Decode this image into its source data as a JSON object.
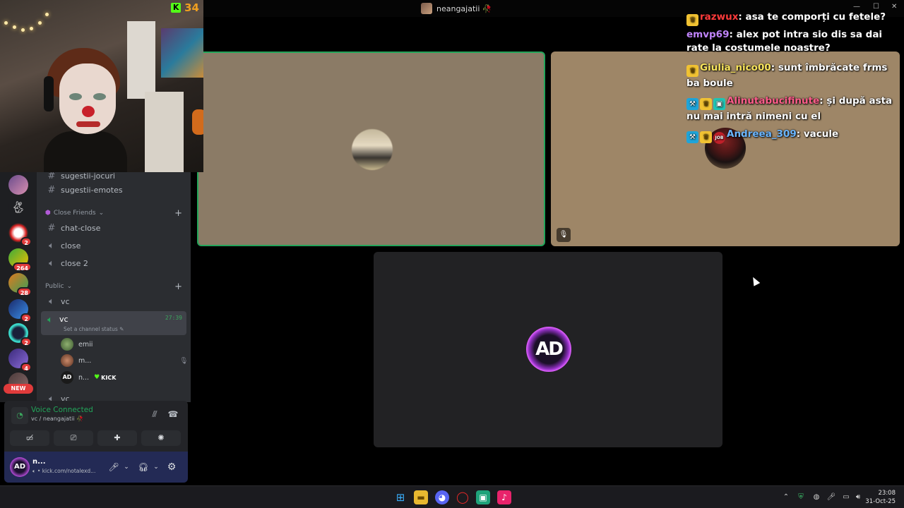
{
  "window": {
    "title": "neangajatii 🥀"
  },
  "webcam": {
    "kick_count": "34"
  },
  "servers": [
    {
      "icon": "server-anime-icon",
      "badge": ""
    },
    {
      "icon": "server-bunny-icon",
      "badge": ""
    },
    {
      "icon": "server-clown-icon",
      "badge": "2"
    },
    {
      "icon": "server-mario-icon",
      "badge": "264"
    },
    {
      "icon": "server-orange-icon",
      "badge": "28"
    },
    {
      "icon": "server-blue-icon",
      "badge": "2"
    },
    {
      "icon": "server-valorant-icon",
      "badge": "2"
    },
    {
      "icon": "server-purple-icon",
      "badge": "4"
    }
  ],
  "servers_new_label": "NEW",
  "channels": {
    "partial_top": "sugestii-jocuri",
    "sugestii_emotes": "sugestii-emotes",
    "cat_close_friends": "Close Friends",
    "chat_close": "chat-close",
    "close": "close",
    "close2": "close 2",
    "cat_public": "Public",
    "vc1": "vc",
    "vc_active": "vc",
    "vc_active_timer": "27:39",
    "vc_status_placeholder": "Set a channel status",
    "members": [
      {
        "name": "emii",
        "tag": ""
      },
      {
        "name": "m...",
        "tag": ""
      },
      {
        "name": "n...",
        "tag": "KICK"
      }
    ],
    "partial_bottom": "vc"
  },
  "voice": {
    "status": "Voice Connected",
    "location": "vc / neangajatii 🥀"
  },
  "user": {
    "name": "n...",
    "status": "kick.com/notalexd..."
  },
  "chat": [
    {
      "badges": [
        "crown",
        "sub"
      ],
      "user": "razwux",
      "color": "#ff3b3b",
      "text": "asa te comporți cu fetele?"
    },
    {
      "badges": [],
      "user": "emvp69",
      "color": "#c084fc",
      "text": "alex pot intra sio dis sa dai rate la costumele noastre?"
    },
    {
      "badges": [
        "crown"
      ],
      "user": "Giulia_nico00",
      "color": "#f8e45c",
      "text": "sunt îmbrăcate frms ba boule"
    },
    {
      "badges": [
        "mod",
        "crown",
        "sub"
      ],
      "user": "Alinutabucifinute",
      "color": "#ff5c8a",
      "text": "și după asta nu mai intră nimeni cu el"
    },
    {
      "badges": [
        "mod",
        "crown",
        "job"
      ],
      "user": "Andreea_309",
      "color": "#6bb6ff",
      "text": "vacule"
    }
  ],
  "tile3": {
    "avatar_text": "AD"
  },
  "clock": {
    "time": "23:08",
    "date": "31-Oct-25"
  },
  "colors": {
    "speaking_border": "#23a55a",
    "badge_red": "#e03b3b",
    "kick_green": "#53fc18"
  }
}
